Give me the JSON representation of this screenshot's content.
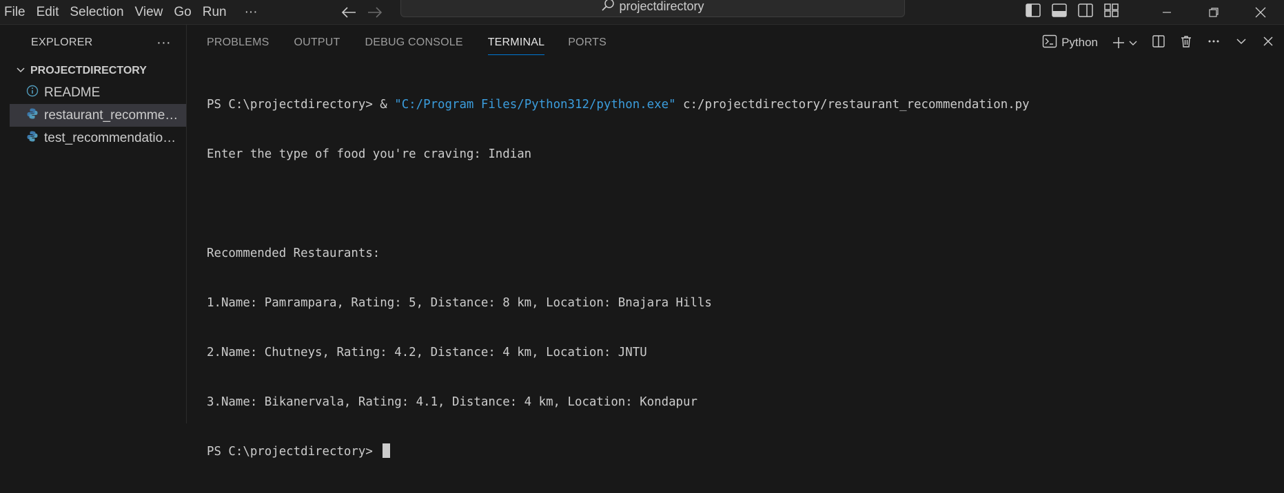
{
  "menu": [
    "File",
    "Edit",
    "Selection",
    "View",
    "Go",
    "Run",
    "···"
  ],
  "search": {
    "text": "projectdirectory"
  },
  "sidebar": {
    "title": "EXPLORER",
    "more": "···",
    "folder": "PROJECTDIRECTORY",
    "items": [
      {
        "label": "README",
        "icon": "info-icon"
      },
      {
        "label": "restaurant_recommendation.py",
        "icon": "python-icon",
        "selected": true
      },
      {
        "label": "test_recommendation.py",
        "icon": "python-icon"
      }
    ]
  },
  "panel": {
    "tabs": [
      "PROBLEMS",
      "OUTPUT",
      "DEBUG CONSOLE",
      "TERMINAL",
      "PORTS"
    ],
    "active_tab": "TERMINAL",
    "shell": "Python"
  },
  "terminal": {
    "cmd_prompt": "PS C:\\projectdirectory> & ",
    "cmd_exe": "\"C:/Program Files/Python312/python.exe\"",
    "cmd_script": " c:/projectdirectory/restaurant_recommendation.py",
    "input_line": "Enter the type of food you're craving: Indian",
    "blank": "",
    "heading": "Recommended Restaurants:",
    "results": [
      "1.Name: Pamrampara, Rating: 5, Distance: 8 km, Location: Bnajara Hills",
      "2.Name: Chutneys, Rating: 4.2, Distance: 4 km, Location: JNTU",
      "3.Name: Bikanervala, Rating: 4.1, Distance: 4 km, Location: Kondapur"
    ],
    "final_prompt": "PS C:\\projectdirectory> "
  },
  "colors": {
    "accent": "#0078d4",
    "string": "#3b9ddd",
    "background": "#181818"
  }
}
